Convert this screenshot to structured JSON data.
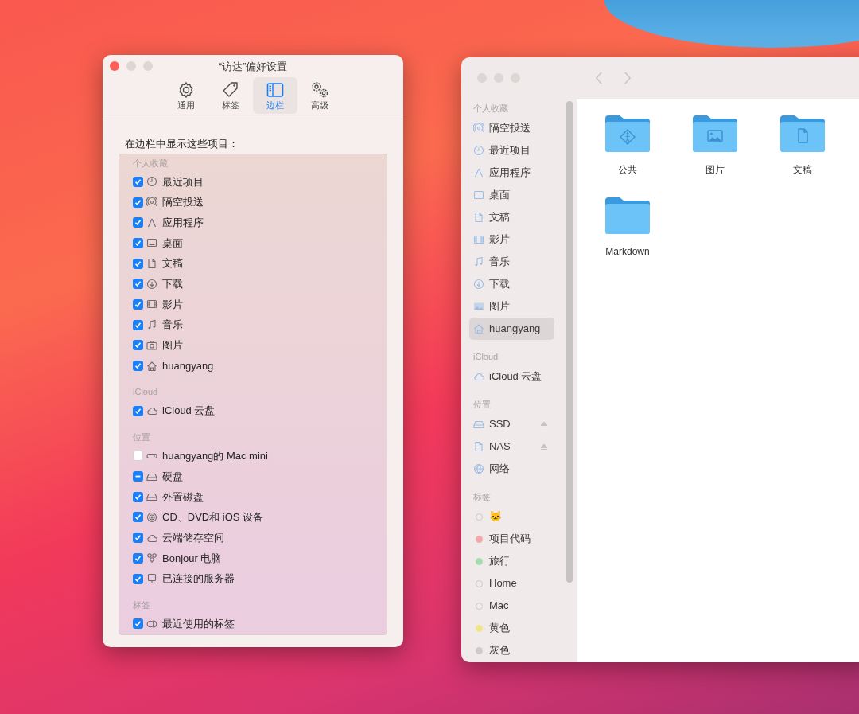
{
  "preferences_window": {
    "title": "“访达”偏好设置",
    "tabs": [
      {
        "label": "通用",
        "selected": false
      },
      {
        "label": "标签",
        "selected": false
      },
      {
        "label": "边栏",
        "selected": true
      },
      {
        "label": "高级",
        "selected": false
      }
    ],
    "heading": "在边栏中显示这些项目：",
    "groups": [
      {
        "header": "个人收藏",
        "items": [
          {
            "label": "最近项目",
            "checked": true,
            "mixed": false
          },
          {
            "label": "隔空投送",
            "checked": true,
            "mixed": false
          },
          {
            "label": "应用程序",
            "checked": true,
            "mixed": false
          },
          {
            "label": "桌面",
            "checked": true,
            "mixed": false
          },
          {
            "label": "文稿",
            "checked": true,
            "mixed": false
          },
          {
            "label": "下载",
            "checked": true,
            "mixed": false
          },
          {
            "label": "影片",
            "checked": true,
            "mixed": false
          },
          {
            "label": "音乐",
            "checked": true,
            "mixed": false
          },
          {
            "label": "图片",
            "checked": true,
            "mixed": false
          },
          {
            "label": "huangyang",
            "checked": true,
            "mixed": false
          }
        ]
      },
      {
        "header": "iCloud",
        "items": [
          {
            "label": "iCloud 云盘",
            "checked": true,
            "mixed": false
          }
        ]
      },
      {
        "header": "位置",
        "items": [
          {
            "label": "huangyang的 Mac mini",
            "checked": false,
            "mixed": false
          },
          {
            "label": "硬盘",
            "checked": true,
            "mixed": true
          },
          {
            "label": "外置磁盘",
            "checked": true,
            "mixed": false
          },
          {
            "label": "CD、DVD和 iOS 设备",
            "checked": true,
            "mixed": false
          },
          {
            "label": "云端储存空间",
            "checked": true,
            "mixed": false
          },
          {
            "label": "Bonjour 电脑",
            "checked": true,
            "mixed": false
          },
          {
            "label": "已连接的服务器",
            "checked": true,
            "mixed": false
          }
        ]
      },
      {
        "header": "标签",
        "items": [
          {
            "label": "最近使用的标签",
            "checked": true,
            "mixed": false
          }
        ]
      }
    ]
  },
  "finder_window": {
    "sidebar": [
      {
        "header": "个人收藏",
        "kind": "places",
        "items": [
          {
            "label": "隔空投送",
            "selected": false
          },
          {
            "label": "最近项目",
            "selected": false
          },
          {
            "label": "应用程序",
            "selected": false
          },
          {
            "label": "桌面",
            "selected": false
          },
          {
            "label": "文稿",
            "selected": false
          },
          {
            "label": "影片",
            "selected": false
          },
          {
            "label": "音乐",
            "selected": false
          },
          {
            "label": "下载",
            "selected": false
          },
          {
            "label": "图片",
            "selected": false
          },
          {
            "label": "huangyang",
            "selected": true
          }
        ]
      },
      {
        "header": "iCloud",
        "kind": "places",
        "items": [
          {
            "label": "iCloud 云盘",
            "selected": false
          }
        ]
      },
      {
        "header": "位置",
        "kind": "places",
        "items": [
          {
            "label": "SSD",
            "selected": false,
            "ejectable": true
          },
          {
            "label": "NAS",
            "selected": false,
            "ejectable": true
          },
          {
            "label": "网络",
            "selected": false,
            "ejectable": false
          }
        ]
      },
      {
        "header": "标签",
        "kind": "tags",
        "items": [
          {
            "label": "🐱",
            "selected": false
          },
          {
            "label": "项目代码",
            "selected": false,
            "color": "#f2a9ad"
          },
          {
            "label": "旅行",
            "selected": false,
            "color": "#a8dcb0"
          },
          {
            "label": "Home",
            "selected": false
          },
          {
            "label": "Mac",
            "selected": false
          },
          {
            "label": "黄色",
            "selected": false,
            "color": "#f0e58c"
          },
          {
            "label": "灰色",
            "selected": false,
            "color": "#cfcccc"
          }
        ]
      }
    ],
    "files": [
      {
        "label": "公共"
      },
      {
        "label": "图片"
      },
      {
        "label": "文稿"
      },
      {
        "label": "Markdown"
      }
    ]
  }
}
